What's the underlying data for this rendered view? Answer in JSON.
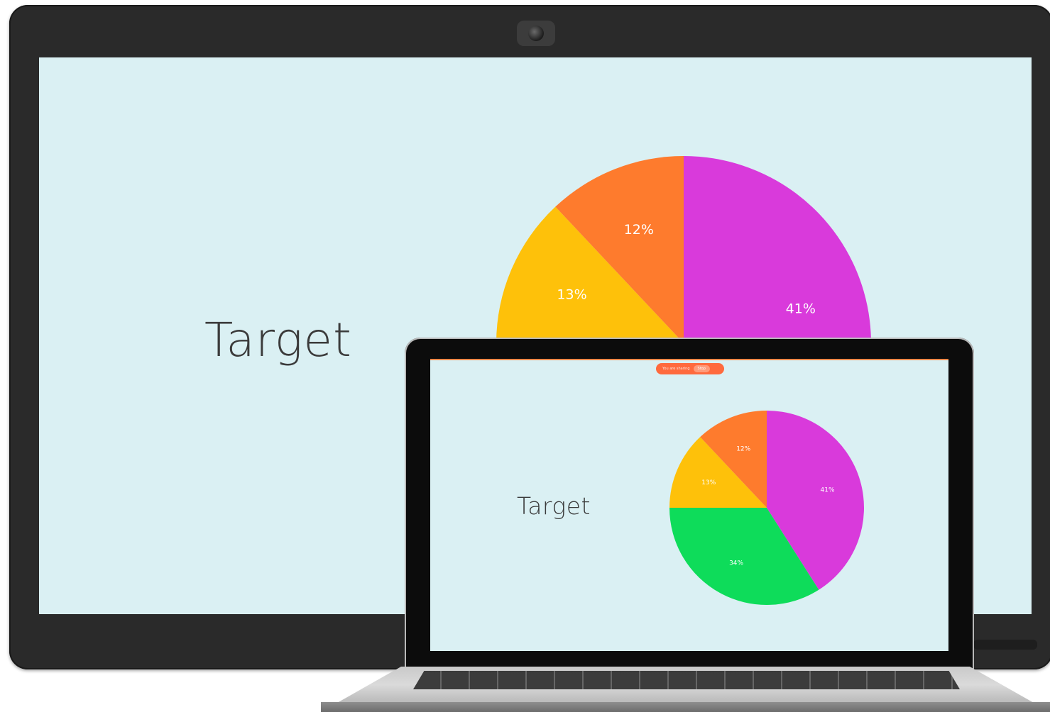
{
  "display": {
    "title": "Target"
  },
  "laptop": {
    "title": "Target",
    "share_banner": {
      "text": "You are sharing",
      "stop_label": "Stop",
      "color": "#ff6a3d"
    }
  },
  "chart_data": {
    "type": "pie",
    "categories": [
      "Magenta",
      "Green",
      "Yellow",
      "Orange"
    ],
    "values": [
      41,
      34,
      13,
      12
    ],
    "labels": [
      "41%",
      "34%",
      "13%",
      "12%"
    ],
    "colors": [
      "#d93adb",
      "#0edc5a",
      "#fec10a",
      "#fe7b2d"
    ],
    "start_angle_deg": 0,
    "direction": "clockwise"
  },
  "colors": {
    "screen_background": "#daf0f3",
    "title_text": "#3b3b3b",
    "bezel": "#2a2a2a"
  }
}
